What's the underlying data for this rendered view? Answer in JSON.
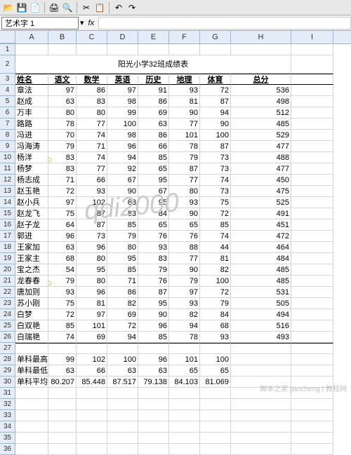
{
  "namebox": "艺术字 1",
  "fx": "fx",
  "columns": [
    "A",
    "B",
    "C",
    "D",
    "E",
    "F",
    "G",
    "H",
    "I"
  ],
  "title": "阳光小学32班成绩表",
  "headers": [
    "姓名",
    "语文",
    "数学",
    "英语",
    "历史",
    "地理",
    "体育",
    "总分"
  ],
  "rows": [
    {
      "r": 4,
      "n": "章法",
      "v": [
        97,
        86,
        97,
        91,
        93,
        72,
        536
      ]
    },
    {
      "r": 5,
      "n": "赵成",
      "v": [
        63,
        83,
        98,
        86,
        81,
        87,
        498
      ]
    },
    {
      "r": 6,
      "n": "万丰",
      "v": [
        80,
        80,
        99,
        69,
        90,
        94,
        512
      ]
    },
    {
      "r": 7,
      "n": "路路",
      "v": [
        78,
        77,
        100,
        63,
        77,
        90,
        485
      ]
    },
    {
      "r": 8,
      "n": "冯进",
      "v": [
        70,
        74,
        98,
        86,
        101,
        100,
        529
      ]
    },
    {
      "r": 9,
      "n": "冯海涛",
      "v": [
        79,
        71,
        96,
        66,
        78,
        87,
        477
      ]
    },
    {
      "r": 10,
      "n": "杨洋",
      "v": [
        83,
        74,
        94,
        85,
        79,
        73,
        488
      ],
      "d": "B"
    },
    {
      "r": 11,
      "n": "杨梦",
      "v": [
        83,
        77,
        92,
        65,
        87,
        73,
        477
      ]
    },
    {
      "r": 12,
      "n": "杨志成",
      "v": [
        71,
        66,
        67,
        95,
        77,
        74,
        450
      ]
    },
    {
      "r": 13,
      "n": "赵玉艳",
      "v": [
        72,
        93,
        90,
        67,
        80,
        73,
        475
      ]
    },
    {
      "r": 14,
      "n": "赵小兵",
      "v": [
        97,
        102,
        63,
        95,
        93,
        75,
        525
      ]
    },
    {
      "r": 15,
      "n": "赵龙飞",
      "v": [
        75,
        87,
        83,
        84,
        90,
        72,
        491
      ]
    },
    {
      "r": 16,
      "n": "赵子龙",
      "v": [
        64,
        87,
        85,
        65,
        65,
        85,
        451
      ],
      "d": "A"
    },
    {
      "r": 17,
      "n": "郭进",
      "v": [
        96,
        73,
        79,
        76,
        76,
        74,
        472
      ]
    },
    {
      "r": 18,
      "n": "王家加",
      "v": [
        63,
        96,
        80,
        93,
        88,
        44,
        464
      ]
    },
    {
      "r": 19,
      "n": "王家主",
      "v": [
        68,
        80,
        95,
        83,
        77,
        81,
        484
      ]
    },
    {
      "r": 20,
      "n": "宝之杰",
      "v": [
        54,
        95,
        85,
        79,
        90,
        82,
        485
      ]
    },
    {
      "r": 21,
      "n": "龙春春",
      "v": [
        79,
        80,
        71,
        76,
        79,
        100,
        485
      ],
      "d": "B"
    },
    {
      "r": 22,
      "n": "唐加则",
      "v": [
        93,
        96,
        86,
        87,
        97,
        72,
        531
      ]
    },
    {
      "r": 23,
      "n": "苏小刚",
      "v": [
        75,
        81,
        82,
        95,
        93,
        79,
        505
      ]
    },
    {
      "r": 24,
      "n": "白梦",
      "v": [
        72,
        97,
        69,
        90,
        82,
        84,
        494
      ]
    },
    {
      "r": 25,
      "n": "白双艳",
      "v": [
        85,
        101,
        72,
        96,
        94,
        68,
        516
      ]
    },
    {
      "r": 26,
      "n": "白瑞艳",
      "v": [
        74,
        69,
        94,
        85,
        78,
        93,
        493
      ]
    }
  ],
  "summary": [
    {
      "r": 28,
      "n": "单科最高分",
      "v": [
        99,
        102,
        100,
        96,
        101,
        100,
        ""
      ]
    },
    {
      "r": 29,
      "n": "单科最低分",
      "v": [
        63,
        66,
        63,
        63,
        65,
        65,
        ""
      ]
    },
    {
      "r": 30,
      "n": "单科平均分",
      "v": [
        "80.207",
        "85.448",
        "87.517",
        "79.138",
        "84.103",
        "81.069",
        ""
      ]
    }
  ],
  "watermark": "qdi2000",
  "footer": "脚本之家 jiaocheng | 教程网"
}
